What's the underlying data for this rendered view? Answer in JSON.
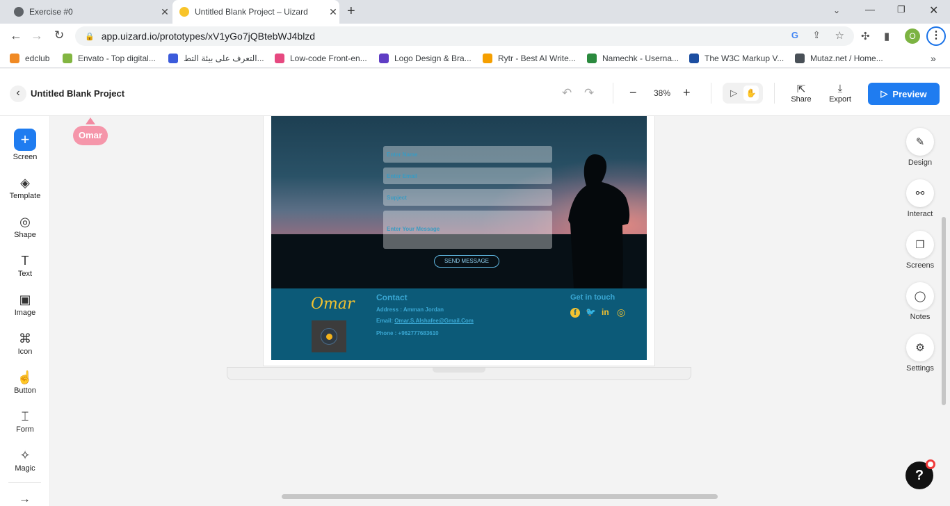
{
  "browser": {
    "tabs": [
      {
        "title": "Exercise #0",
        "close": "✕"
      },
      {
        "title": "Untitled Blank Project – Uizard",
        "close": "✕"
      }
    ],
    "new_tab": "+",
    "url": "app.uizard.io/prototypes/xV1yGo7jQBtebWJ4blzd",
    "profile_initial": "O",
    "bookmarks": [
      {
        "label": "edclub",
        "color": "#f08a24"
      },
      {
        "label": "Envato - Top digital...",
        "color": "#82b541"
      },
      {
        "label": "التعرف على بيئة التط...",
        "color": "#3b5bdb"
      },
      {
        "label": "Low-code Front-en...",
        "color": "#e64980"
      },
      {
        "label": "Logo Design & Bra...",
        "color": "#5f3dc4"
      },
      {
        "label": "Rytr - Best AI Write...",
        "color": "#f59f00"
      },
      {
        "label": "Namechk - Userna...",
        "color": "#2b8a3e"
      },
      {
        "label": "The W3C Markup V...",
        "color": "#1c4ea1"
      },
      {
        "label": "Mutaz.net / Home...",
        "color": "#495057"
      }
    ],
    "more_bookmarks": "»"
  },
  "app": {
    "back_label": "‹",
    "project_title": "Untitled Blank Project",
    "undo": "↶",
    "redo": "↷",
    "zoom_out": "−",
    "zoom_level": "38%",
    "zoom_in": "+",
    "play_icon": "▷",
    "hand_icon": "✋",
    "share_label": "Share",
    "export_label": "Export",
    "preview_label": "Preview",
    "accent": "#1f7cf0"
  },
  "left_tools": [
    {
      "name": "screen",
      "label": "Screen",
      "icon": "+"
    },
    {
      "name": "template",
      "label": "Template",
      "icon": "◈"
    },
    {
      "name": "shape",
      "label": "Shape",
      "icon": "◎"
    },
    {
      "name": "text",
      "label": "Text",
      "icon": "T"
    },
    {
      "name": "image",
      "label": "Image",
      "icon": "▣"
    },
    {
      "name": "icon",
      "label": "Icon",
      "icon": "⌘"
    },
    {
      "name": "button",
      "label": "Button",
      "icon": "☝"
    },
    {
      "name": "form",
      "label": "Form",
      "icon": "⌶"
    },
    {
      "name": "magic",
      "label": "Magic",
      "icon": "✧"
    }
  ],
  "left_bottom_arrow": "→",
  "right_tools": [
    {
      "name": "design",
      "label": "Design",
      "icon": "✎"
    },
    {
      "name": "interact",
      "label": "Interact",
      "icon": "⚯"
    },
    {
      "name": "screens",
      "label": "Screens",
      "icon": "❐"
    },
    {
      "name": "notes",
      "label": "Notes",
      "icon": "◯"
    },
    {
      "name": "settings",
      "label": "Settings",
      "icon": "⚙"
    }
  ],
  "cursor_user": "Omar",
  "canvas": {
    "fields": [
      "Enter Name",
      "Enter Email",
      "Supject",
      "Enter Your Message"
    ],
    "send_button": "SEND MESSAGE",
    "footer": {
      "brand": "Omar",
      "contact_heading": "Contact",
      "address": "Address : Amman Jordan",
      "email_label": "Email: ",
      "email": "Omar.S.Alshafee@Gmail.Com",
      "phone": "Phone : +962777683610",
      "get_in_touch": "Get in touch",
      "social": [
        "f",
        "🐦",
        "in",
        "◎"
      ]
    }
  },
  "help": "?"
}
